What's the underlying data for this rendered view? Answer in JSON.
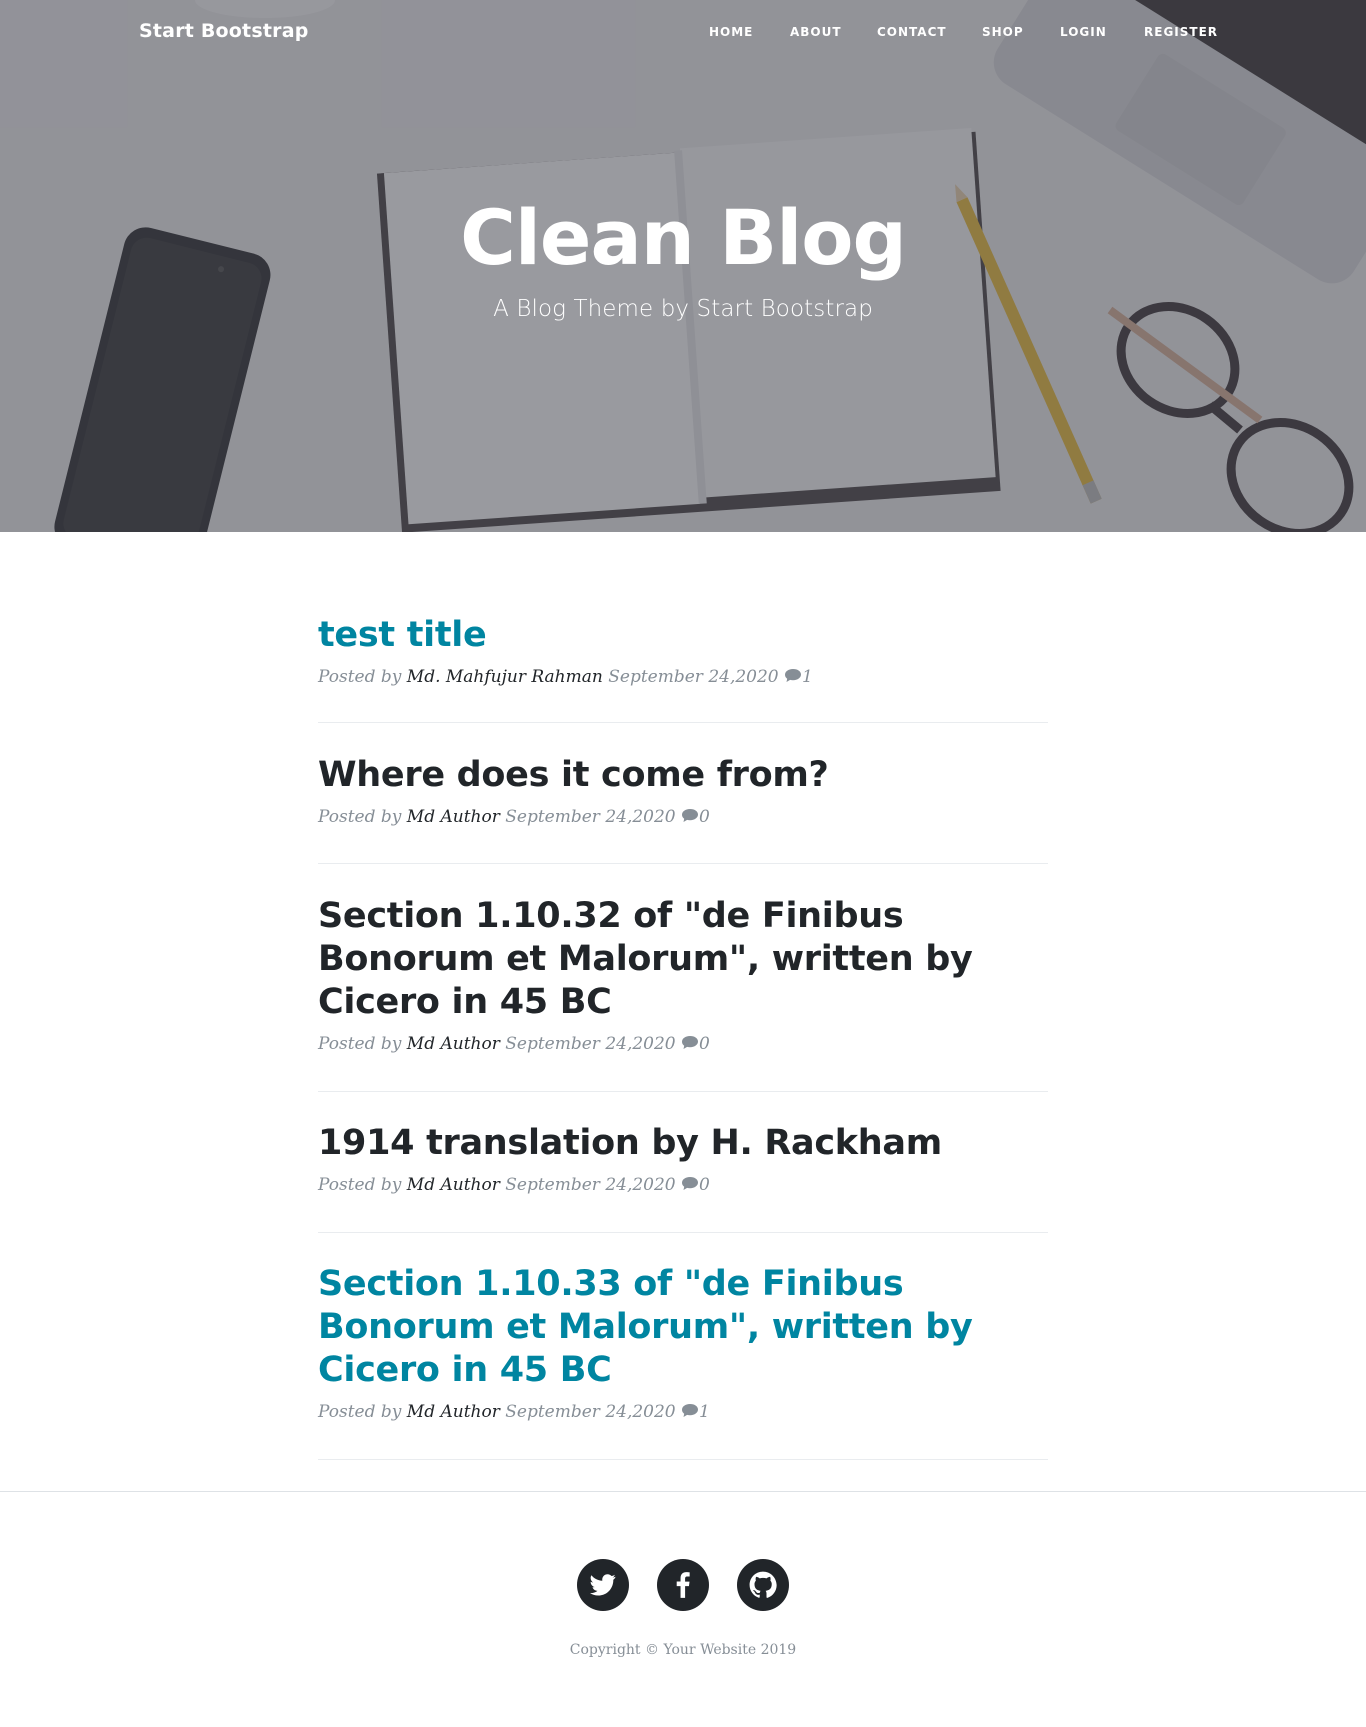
{
  "navbar": {
    "brand": "Start Bootstrap",
    "links": [
      "HOME",
      "ABOUT",
      "CONTACT",
      "SHOP",
      "LOGIN",
      "REGISTER"
    ]
  },
  "hero": {
    "title": "Clean Blog",
    "subtitle": "A Blog Theme by Start Bootstrap"
  },
  "posts": [
    {
      "title": "test title",
      "meta_prefix": "Posted by",
      "author": "Md. Mahfujur Rahman",
      "date": "September 24,2020",
      "comments": "1"
    },
    {
      "title": "Where does it come from?",
      "meta_prefix": "Posted by",
      "author": "Md Author",
      "date": "September 24,2020",
      "comments": "0"
    },
    {
      "title": "Section 1.10.32 of \"de Finibus Bonorum et Malorum\", written by Cicero in 45 BC",
      "meta_prefix": "Posted by",
      "author": "Md Author",
      "date": "September 24,2020",
      "comments": "0"
    },
    {
      "title": "1914 translation by H. Rackham",
      "meta_prefix": "Posted by",
      "author": "Md Author",
      "date": "September 24,2020",
      "comments": "0"
    },
    {
      "title": "Section 1.10.33 of \"de Finibus Bonorum et Malorum\", written by Cicero in 45 BC",
      "meta_prefix": "Posted by",
      "author": "Md Author",
      "date": "September 24,2020",
      "comments": "1"
    }
  ],
  "footer": {
    "social": [
      "twitter-icon",
      "facebook-icon",
      "github-icon"
    ],
    "copyright": "Copyright © Your Website 2019"
  },
  "colors": {
    "accent": "#0085a1",
    "text": "#212529",
    "muted": "#868e96"
  }
}
